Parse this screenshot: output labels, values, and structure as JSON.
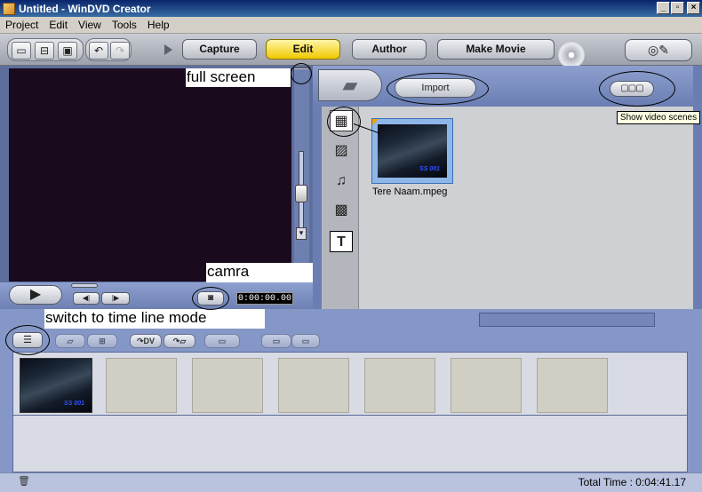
{
  "window": {
    "title": "Untitled - WinDVD Creator",
    "buttons": {
      "minimize": "_",
      "maximize": "▫",
      "close": "×"
    }
  },
  "menu": [
    "Project",
    "Edit",
    "View",
    "Tools",
    "Help"
  ],
  "toolbar": {
    "steps": [
      "Capture",
      "Edit",
      "Author",
      "Make Movie"
    ],
    "active_step": "Edit",
    "icons": [
      "new-project-icon",
      "open-project-icon",
      "save-project-icon",
      "undo-icon",
      "redo-icon"
    ]
  },
  "preview": {
    "timecode": "0:00:00.00",
    "play_label": "▶",
    "prev_label": "◀|",
    "next_label": "|▶"
  },
  "library": {
    "import_label": "Import",
    "scenes_button_label": "▢▢▢",
    "tooltip": "Show video scenes",
    "clip": {
      "name": "Tere Naam.mpeg",
      "tag": "SS 001"
    }
  },
  "storyboard": {
    "clip_tag": "SS 001",
    "empty_slots": 6,
    "tool_buttons": [
      "DV",
      "▱"
    ]
  },
  "status": {
    "total_time": "Total Time : 0:04:41.17"
  },
  "annotations": {
    "full_screen": "full screen",
    "camera": "camra",
    "timeline": "switch to time line mode"
  },
  "colors": {
    "panel_blue": "#6a7eb3",
    "active_step": "#f0c800",
    "preview_bg": "#1a0a1e"
  }
}
